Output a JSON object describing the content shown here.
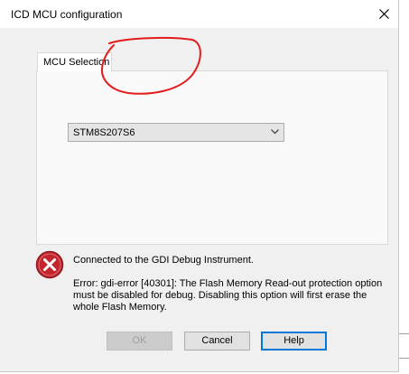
{
  "window": {
    "title": "ICD MCU configuration"
  },
  "tabs": [
    {
      "label": "MCU Selection",
      "active": true
    }
  ],
  "mcu_select": {
    "selected": "STM8S207S6"
  },
  "status": {
    "connected_text": "Connected to the GDI Debug Instrument.",
    "error_text": "Error: gdi-error [40301]: The Flash Memory Read-out protection option must be disabled for debug. Disabling this option will first erase the whole Flash Memory."
  },
  "buttons": {
    "ok": "OK",
    "cancel": "Cancel",
    "help": "Help"
  },
  "colors": {
    "annotation_circle": "#e31c1c",
    "error_icon": "#c4262e",
    "default_button_border": "#0078d7"
  },
  "icons": {
    "close": "close-icon",
    "dropdown": "chevron-down-icon",
    "error": "error-icon"
  }
}
